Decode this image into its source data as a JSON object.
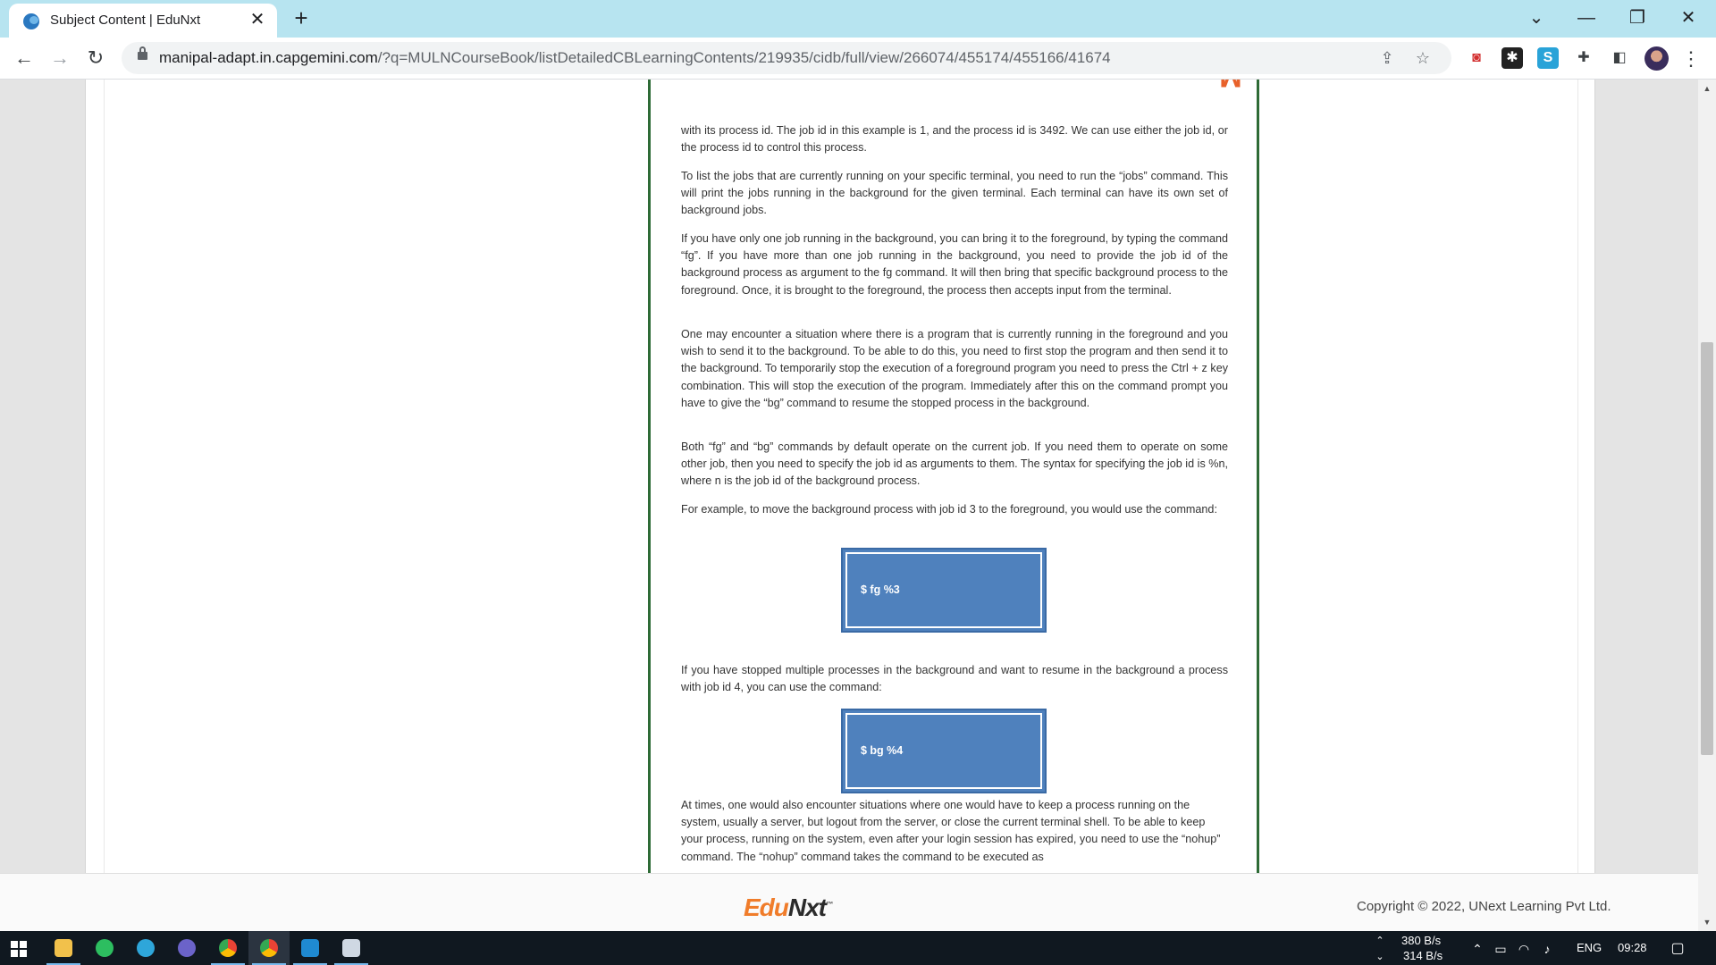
{
  "browser": {
    "tab_title": "Subject Content | EduNxt",
    "tab_close": "✕",
    "new_tab": "+",
    "url_host": "manipal-adapt.in.capgemini.com",
    "url_path": "/?q=MULNCourseBook/listDetailedCBLearningContents/219935/cidb/full/view/266074/455174/455166/41674",
    "back": "←",
    "forward": "→",
    "reload": "↻",
    "minimize": "—",
    "restore": "❐",
    "close": "✕",
    "tab_search": "⌄",
    "share": "⇪",
    "star": "☆",
    "menu": "⋮"
  },
  "document": {
    "paragraphs": [
      "with its process id. The job id in this example is 1, and the process id is 3492. We can use either the job id, or the process id to control this process.",
      "To list the jobs that are currently running on your specific terminal, you need to run the “jobs” command. This will print the jobs running in the background for the given terminal. Each terminal can have its own set of background jobs.",
      "If you have only one job running in the background, you can bring it to the foreground, by typing the command “fg”. If you have more than one job running in the background, you need to provide the job id of the background process as argument to the fg command. It will then bring that specific background process to the foreground. Once, it is brought to the foreground, the process then accepts input from the terminal.",
      "One may encounter a situation where there is a program that is currently running in the foreground and you wish to send it to the background. To be able to do this, you need to first stop the program and then send it to the background. To temporarily stop the execution of a foreground program you need to press the Ctrl + z key combination. This will stop the execution of the program. Immediately after this on the command prompt you have to give the “bg” command to resume the stopped process in the background.",
      "Both “fg” and “bg” commands by default operate on the current job. If you need them to operate on some other job, then you need to specify the job id as arguments to them. The syntax for specifying the job id is %n, where n is the job id of the background process.",
      "For example, to move the background process with job id 3 to the foreground, you would use the command:",
      "If you have stopped multiple processes in the background and want to resume in the background a process with job id 4, you can use the command:",
      "At times, one would also encounter situations where one would have to keep a process running on the system, usually a server, but logout from the server, or close the current terminal shell. To be able to keep your process, running on the system, even after your login session has expired, you need to use the “nohup” command. The “nohup” command takes the command to be executed as"
    ],
    "command_1": "$ fg %3",
    "command_2": "$ bg %4"
  },
  "footer": {
    "logo_edu": "Edu",
    "logo_nxt": "Nxt",
    "logo_tm": "™",
    "copyright": "Copyright © 2022, UNext Learning Pvt Ltd."
  },
  "taskbar": {
    "net_up": "380 B/s",
    "net_down": "314 B/s",
    "language": "ENG",
    "time": "09:28"
  },
  "colors": {
    "tabstrip": "#b7e4f0",
    "doc_border": "#2e6b36",
    "command_box": "#4f81bd",
    "brand_orange": "#f07c2a"
  }
}
